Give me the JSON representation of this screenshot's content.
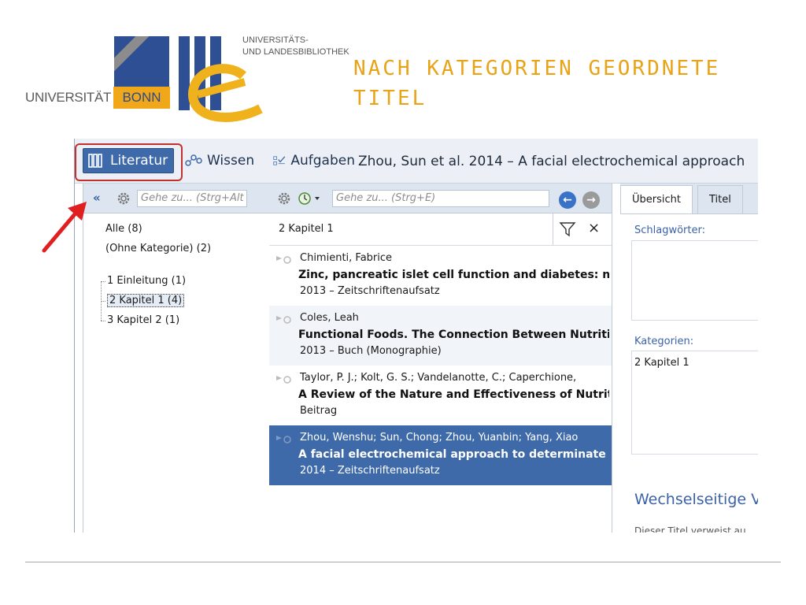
{
  "logo": {
    "university": "UNIVERSITÄT",
    "bonn": "BONN",
    "library_line1": "UNIVERSITÄTS-",
    "library_line2": "UND LANDESBIBLIOTHEK"
  },
  "slide": {
    "title_line1": "NACH KATEGORIEN GEORDNETE",
    "title_line2": "TITEL",
    "title_color": "#e8a317"
  },
  "app": {
    "tabs": [
      {
        "label": "Literatur",
        "icon": "books-icon",
        "active": true
      },
      {
        "label": "Wissen",
        "icon": "knowledge-network-icon"
      },
      {
        "label": "Aufgaben",
        "icon": "tasks-checklist-icon"
      }
    ],
    "window_title": "Zhou, Sun et al. 2014 – A facial electrochemical approach",
    "left": {
      "search_placeholder": "Gehe zu... (Strg+Alt",
      "categories": [
        "Alle (8)",
        "(Ohne Kategorie) (2)"
      ],
      "tree": [
        {
          "label": "1 Einleitung (1)",
          "selected": false
        },
        {
          "label": "2 Kapitel 1 (4)",
          "selected": true
        },
        {
          "label": "3 Kapitel 2 (1)",
          "selected": false
        }
      ]
    },
    "middle": {
      "search_placeholder": "Gehe zu... (Strg+E)",
      "filter_label": "2 Kapitel 1",
      "entries": [
        {
          "authors": "Chimienti, Fabrice",
          "title": "Zinc, pancreatic islet cell function and diabetes: ne",
          "meta": "2013 – Zeitschriftenaufsatz"
        },
        {
          "authors": "Coles, Leah",
          "title": "Functional Foods. The Connection Between Nutritio",
          "meta": "2013 – Buch (Monographie)"
        },
        {
          "authors": "Taylor, P. J.; Kolt, G. S.; Vandelanotte, C.; Caperchione,",
          "title": "A Review of the Nature and Effectiveness of Nutriti",
          "meta": "Beitrag"
        },
        {
          "authors": "Zhou, Wenshu; Sun, Chong; Zhou, Yuanbin; Yang, Xiao",
          "title": "A facial electrochemical approach to determinate bi",
          "meta": "2014 – Zeitschriftenaufsatz"
        }
      ]
    },
    "right": {
      "tabs": [
        "Übersicht",
        "Titel"
      ],
      "keywords_label": "Schlagwörter:",
      "categories_label": "Kategorien:",
      "category_value": "2 Kapitel 1",
      "references_heading": "Wechselseitige Ve",
      "references_text": "Dieser Titel verweist au"
    },
    "colors": {
      "accent": "#3f6aa9",
      "highlight": "#c0312d",
      "arrow": "#e02020"
    }
  }
}
